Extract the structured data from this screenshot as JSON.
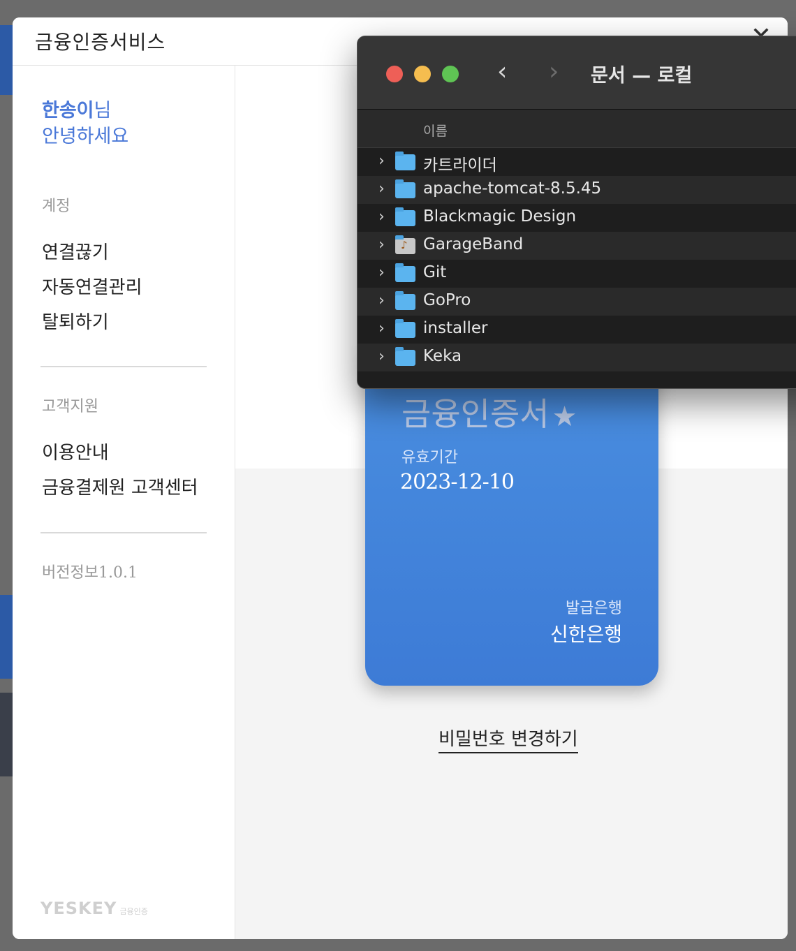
{
  "modal": {
    "title": "금융인증서비스",
    "close_glyph": "✕"
  },
  "sidebar": {
    "greeting_name": "한송이",
    "greeting_suffix": "님",
    "greeting_line2": "안녕하세요",
    "section_account": "계정",
    "account_items": [
      "연결끊기",
      "자동연결관리",
      "탈퇴하기"
    ],
    "section_support": "고객지원",
    "support_items": [
      "이용안내",
      "금융결제원 고객센터"
    ],
    "version": "버전정보1.0.1",
    "logo_main": "YESKEY",
    "logo_sub": "금융인증"
  },
  "certificate": {
    "title": "금융인증서",
    "star_glyph": "★",
    "validity_label": "유효기간",
    "validity_date": "2023-12-10",
    "issuer_label": "발급은행",
    "issuer_name": "신한은행"
  },
  "change_password_link": "비밀번호 변경하기",
  "finder": {
    "title": "문서 — 로컬",
    "back_glyph": "‹",
    "forward_glyph": "›",
    "column_name": "이름",
    "items": [
      {
        "name": "카트라이더",
        "icon": "folder-icon"
      },
      {
        "name": "apache-tomcat-8.5.45",
        "icon": "folder-icon"
      },
      {
        "name": "Blackmagic Design",
        "icon": "folder-icon"
      },
      {
        "name": "GarageBand",
        "icon": "garageband-folder-icon"
      },
      {
        "name": "Git",
        "icon": "folder-icon"
      },
      {
        "name": "GoPro",
        "icon": "folder-icon"
      },
      {
        "name": "installer",
        "icon": "folder-icon"
      },
      {
        "name": "Keka",
        "icon": "folder-icon"
      }
    ]
  },
  "colors": {
    "accent_blue": "#4a78d8",
    "card_blue": "#3d7bd6",
    "finder_bg": "#1e1e1e"
  }
}
